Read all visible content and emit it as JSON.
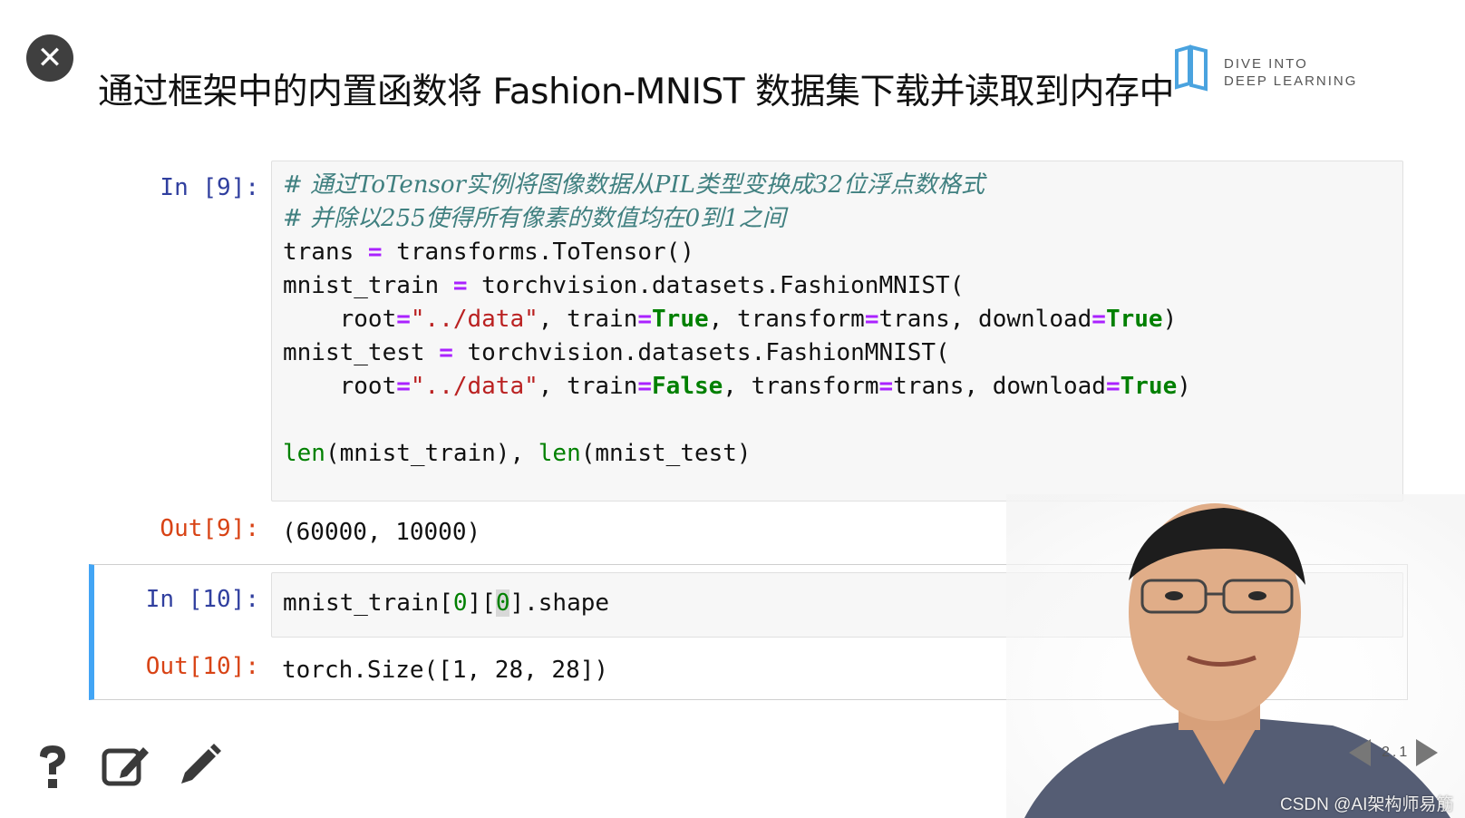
{
  "slide": {
    "title": "通过框架中的内置函数将 Fashion-MNIST 数据集下载并读取到内存中",
    "logo_line1": "DIVE INTO",
    "logo_line2": "DEEP LEARNING",
    "page_number": "2.1"
  },
  "cell9": {
    "in_prompt": "In [9]:",
    "comment1": "# 通过ToTensor实例将图像数据从PIL类型变换成32位浮点数格式",
    "comment2": "# 并除以255使得所有像素的数值均在0到1之间",
    "out_prompt": "Out[9]:",
    "output": "(60000, 10000)"
  },
  "cell10": {
    "in_prompt": "In [10]:",
    "out_prompt": "Out[10]:",
    "output": "torch.Size([1, 28, 28])"
  },
  "toolbar": {
    "help_icon": "question-icon",
    "edit_icon": "edit-box-icon",
    "pencil_icon": "pencil-icon"
  },
  "watermark": "CSDN @AI架构师易筋",
  "colors": {
    "in_prompt": "#303f9f",
    "out_prompt": "#d84315",
    "selected_cell_border": "#42a5f5",
    "keyword": "#008000",
    "operator": "#aa22ff",
    "string": "#ba2121",
    "comment": "#408080"
  }
}
